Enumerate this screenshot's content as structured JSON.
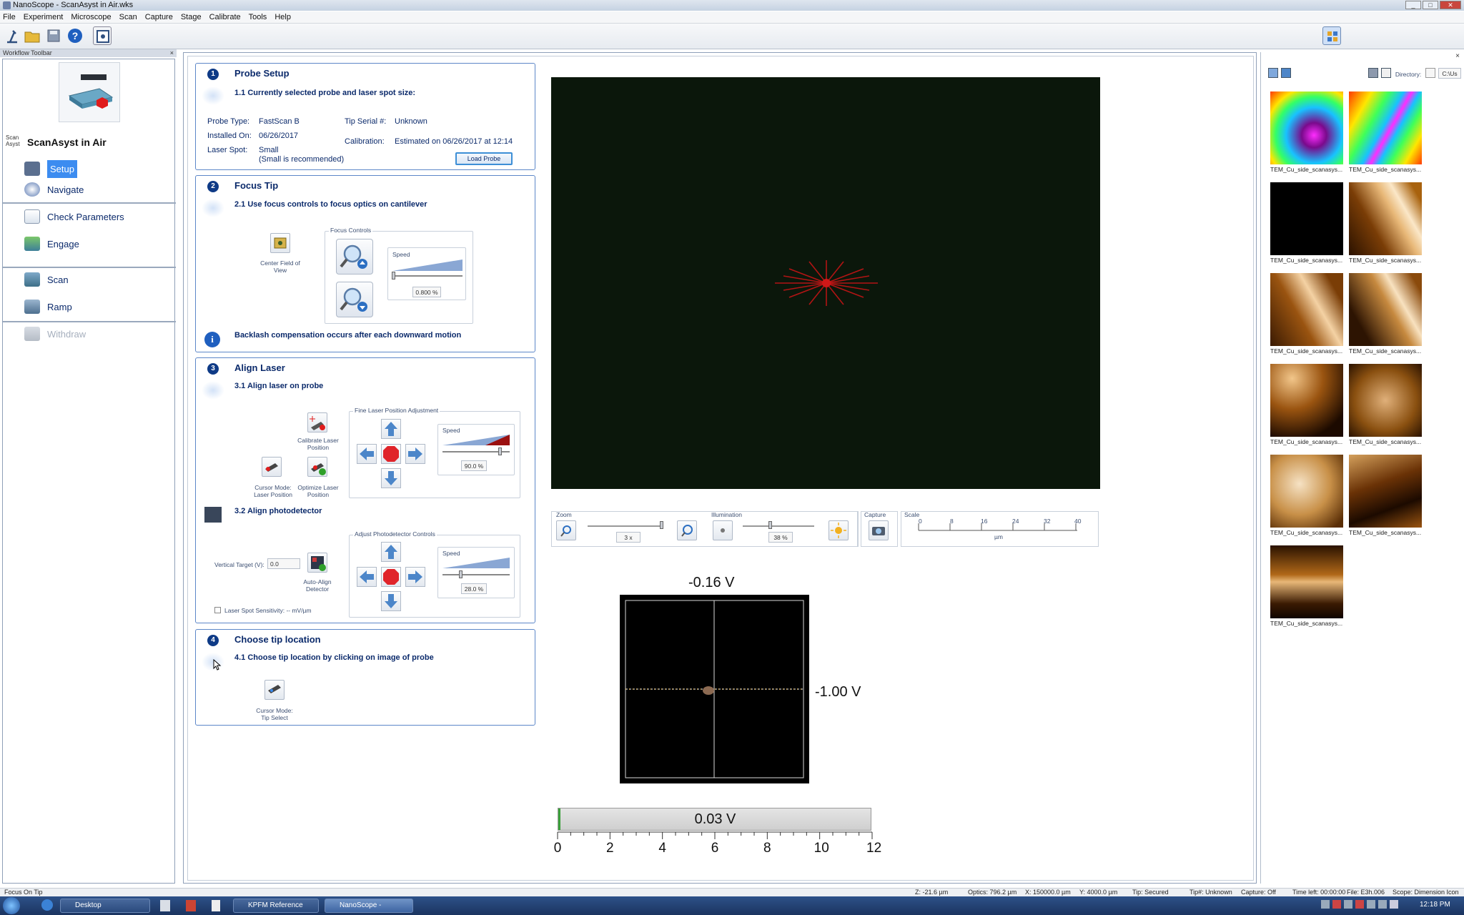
{
  "window": {
    "title": "NanoScope - ScanAsyst in Air.wks"
  },
  "menu": [
    "File",
    "Experiment",
    "Microscope",
    "Scan",
    "Capture",
    "Stage",
    "Calibrate",
    "Tools",
    "Help"
  ],
  "workflow_toolbar": {
    "label": "Workflow Toolbar",
    "close": "×",
    "mode_badge": "Scan Asyst",
    "mode_title": "ScanAsyst in Air",
    "items": [
      {
        "label": "Setup",
        "selected": true
      },
      {
        "label": "Navigate"
      },
      {
        "label": "Check Parameters"
      },
      {
        "label": "Engage"
      },
      {
        "label": "Scan"
      },
      {
        "label": "Ramp"
      },
      {
        "label": "Withdraw",
        "disabled": true
      }
    ]
  },
  "probe_setup": {
    "step": "1",
    "title": "Probe Setup",
    "substep": "1.1 Currently selected probe and laser spot size:",
    "probe_type_label": "Probe Type:",
    "probe_type": "FastScan B",
    "installed_label": "Installed On:",
    "installed": "06/26/2017",
    "laser_spot_label": "Laser Spot:",
    "laser_spot": "Small",
    "laser_spot_note": "(Small is recommended)",
    "tip_serial_label": "Tip Serial #:",
    "tip_serial": "Unknown",
    "calibration_label": "Calibration:",
    "calibration": "Estimated on 06/26/2017 at 12:14",
    "load_probe": "Load Probe"
  },
  "focus_tip": {
    "step": "2",
    "title": "Focus Tip",
    "substep": "2.1 Use focus controls to focus optics on cantilever",
    "center_fov": "Center Field of View",
    "focus_controls": "Focus Controls",
    "speed_label": "Speed",
    "speed_value": "0.800 %",
    "speed_level": 0.01,
    "info": "Backlash compensation occurs after each downward motion"
  },
  "align_laser": {
    "step": "3",
    "title": "Align Laser",
    "substep1": "3.1 Align laser on probe",
    "calibrate_laser": "Calibrate Laser Position",
    "cursor_mode_laser": "Cursor Mode: Laser Position",
    "optimize_laser": "Optimize Laser Position",
    "fine_laser": "Fine Laser Position Adjustment",
    "speed_label": "Speed",
    "laser_speed": "90.0 %",
    "laser_speed_level": 0.9,
    "substep2": "3.2 Align photodetector",
    "vertical_target_label": "Vertical Target (V):",
    "vertical_target": "0.0",
    "auto_align": "Auto-Align Detector",
    "adjust_pd": "Adjust Photodetector Controls",
    "pd_speed": "28.0 %",
    "pd_speed_level": 0.28,
    "laser_sensitivity": "Laser Spot Sensitivity:  -- mV/µm"
  },
  "tip_location": {
    "step": "4",
    "title": "Choose tip location",
    "substep": "4.1 Choose tip location by clicking on image of probe",
    "cursor_mode_tip": "Cursor Mode: Tip Select"
  },
  "video_controls": {
    "zoom_label": "Zoom",
    "zoom_value": "3 x",
    "zoom_level": 0.97,
    "illumination_label": "Illumination",
    "illumination_value": "38 %",
    "illumination_level": 0.38,
    "capture_label": "Capture",
    "scale_label": "Scale",
    "scale_ticks": [
      "0",
      "8",
      "16",
      "24",
      "32",
      "40"
    ],
    "scale_unit": "µm"
  },
  "detector": {
    "vertical": "-0.16 V",
    "horizontal": "-1.00 V",
    "sum": "0.03  V",
    "sum_scale": [
      "0",
      "2",
      "4",
      "6",
      "8",
      "10",
      "12"
    ]
  },
  "thumbnails": {
    "directory_label": "Directory:",
    "directory": "C:\\Us",
    "items": [
      {
        "caption": "TEM_Cu_side_scanasys...",
        "style": "rainbow1"
      },
      {
        "caption": "TEM_Cu_side_scanasys...",
        "style": "rainbow2"
      },
      {
        "caption": "TEM_Cu_side_scanasys...",
        "style": "black"
      },
      {
        "caption": "TEM_Cu_side_scanasys...",
        "style": "gold1"
      },
      {
        "caption": "TEM_Cu_side_scanasys...",
        "style": "gold2"
      },
      {
        "caption": "TEM_Cu_side_scanasys...",
        "style": "gold3"
      },
      {
        "caption": "TEM_Cu_side_scanasys...",
        "style": "gold4"
      },
      {
        "caption": "TEM_Cu_side_scanasys...",
        "style": "gold5"
      },
      {
        "caption": "TEM_Cu_side_scanasys...",
        "style": "gold6"
      },
      {
        "caption": "TEM_Cu_side_scanasys...",
        "style": "gold7"
      },
      {
        "caption": "TEM_Cu_side_scanasys...",
        "style": "gold8"
      }
    ]
  },
  "status": {
    "left": "Focus On Tip",
    "z": "Z: -21.6 µm",
    "optics": "Optics: 796.2 µm",
    "x": "X: 150000.0 µm",
    "y": "Y: 4000.0 µm",
    "tip": "Tip: Secured",
    "tipnum": "Tip#: Unknown",
    "capture": "Capture: Off",
    "timeleft": "Time left: 00:00:00",
    "file": "File: E3h.006",
    "scope": "Scope: Dimension Icon"
  },
  "taskbar": {
    "desktop": "Desktop",
    "task1": "KPFM Reference Sa...",
    "task2": "NanoScope - ScanAs...",
    "time": "12:18 PM"
  },
  "colors": {
    "accent": "#0e3a86",
    "selected": "#3c8cf0",
    "stop": "#e0242a",
    "speed_high": "#9b1010"
  }
}
